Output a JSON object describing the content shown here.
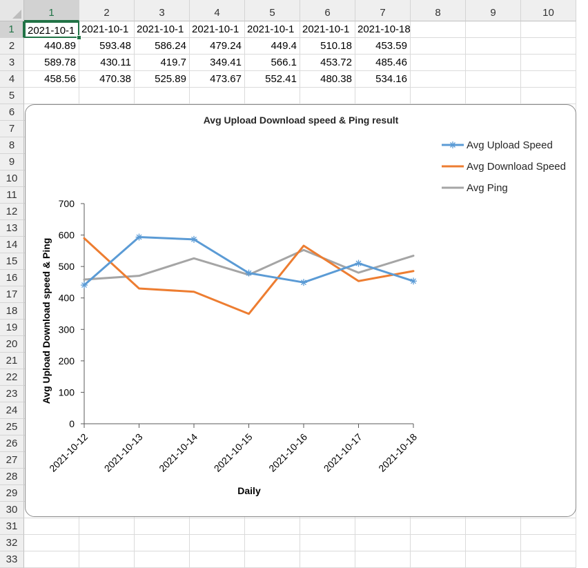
{
  "spreadsheet": {
    "column_headers": [
      "1",
      "2",
      "3",
      "4",
      "5",
      "6",
      "7",
      "8",
      "9",
      "10"
    ],
    "row_headers": [
      "1",
      "2",
      "3",
      "4",
      "5",
      "6",
      "7",
      "8",
      "9",
      "10",
      "11",
      "12",
      "13",
      "14",
      "15",
      "16",
      "17",
      "18",
      "19",
      "20",
      "21",
      "22",
      "23",
      "24",
      "25",
      "26",
      "27",
      "28",
      "29",
      "30",
      "31",
      "32",
      "33"
    ],
    "selected_cell": "1,1",
    "rows": [
      [
        "2021-10-1",
        "2021-10-1",
        "2021-10-1",
        "2021-10-1",
        "2021-10-1",
        "2021-10-1",
        "2021-10-18"
      ],
      [
        "440.89",
        "593.48",
        "586.24",
        "479.24",
        "449.4",
        "510.18",
        "453.59"
      ],
      [
        "589.78",
        "430.11",
        "419.7",
        "349.41",
        "566.1",
        "453.72",
        "485.46"
      ],
      [
        "458.56",
        "470.38",
        "525.89",
        "473.67",
        "552.41",
        "480.38",
        "534.16"
      ]
    ]
  },
  "chart": {
    "title": "Avg Upload Download speed & Ping result",
    "legend": [
      "Avg Upload Speed",
      "Avg Download Speed",
      "Avg Ping"
    ]
  },
  "chart_data": {
    "type": "line",
    "title": "Avg Upload Download speed & Ping result",
    "xlabel": "Daily",
    "ylabel": "Avg Upload Download speed & Ping",
    "categories": [
      "2021-10-12",
      "2021-10-13",
      "2021-10-14",
      "2021-10-15",
      "2021-10-16",
      "2021-10-17",
      "2021-10-18"
    ],
    "ylim": [
      0,
      700
    ],
    "yticks": [
      0,
      100,
      200,
      300,
      400,
      500,
      600,
      700
    ],
    "grid": false,
    "legend_position": "top-right",
    "series": [
      {
        "name": "Avg Upload Speed",
        "color": "#5b9bd5",
        "marker": "asterisk",
        "values": [
          440.89,
          593.48,
          586.24,
          479.24,
          449.4,
          510.18,
          453.59
        ]
      },
      {
        "name": "Avg Download Speed",
        "color": "#ed7d31",
        "marker": "none",
        "values": [
          589.78,
          430.11,
          419.7,
          349.41,
          566.1,
          453.72,
          485.46
        ]
      },
      {
        "name": "Avg Ping",
        "color": "#a5a5a5",
        "marker": "none",
        "values": [
          458.56,
          470.38,
          525.89,
          473.67,
          552.41,
          480.38,
          534.16
        ]
      }
    ]
  }
}
